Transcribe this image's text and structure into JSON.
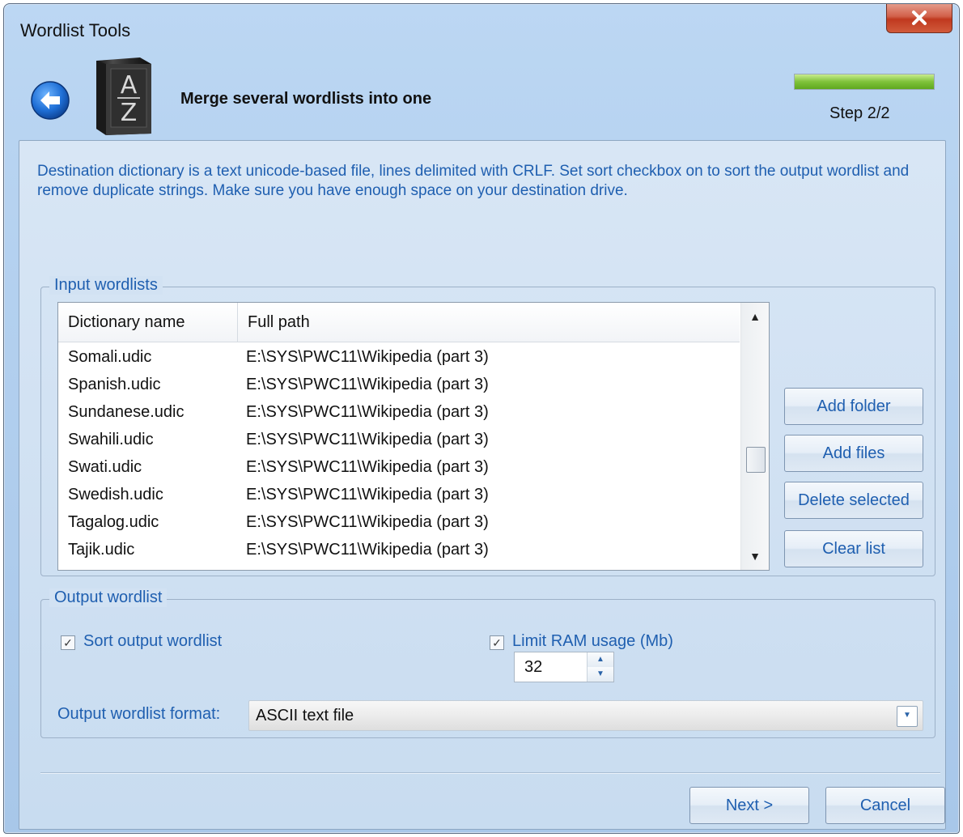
{
  "window": {
    "title": "Wordlist Tools"
  },
  "header": {
    "title": "Merge several wordlists into one",
    "step": "Step 2/2",
    "progress": 1.0
  },
  "description": "Destination dictionary is a text unicode-based file, lines delimited with CRLF. Set sort checkbox on to sort the output wordlist and remove duplicate strings. Make sure you have enough space on your destination drive.",
  "input_group": {
    "legend": "Input wordlists",
    "columns": [
      "Dictionary name",
      "Full path"
    ],
    "rows": [
      {
        "name": "Somali.udic",
        "path": "E:\\SYS\\PWC11\\Wikipedia (part 3)"
      },
      {
        "name": "Spanish.udic",
        "path": "E:\\SYS\\PWC11\\Wikipedia (part 3)"
      },
      {
        "name": "Sundanese.udic",
        "path": "E:\\SYS\\PWC11\\Wikipedia (part 3)"
      },
      {
        "name": "Swahili.udic",
        "path": "E:\\SYS\\PWC11\\Wikipedia (part 3)"
      },
      {
        "name": "Swati.udic",
        "path": "E:\\SYS\\PWC11\\Wikipedia (part 3)"
      },
      {
        "name": "Swedish.udic",
        "path": "E:\\SYS\\PWC11\\Wikipedia (part 3)"
      },
      {
        "name": "Tagalog.udic",
        "path": "E:\\SYS\\PWC11\\Wikipedia (part 3)"
      },
      {
        "name": "Tajik.udic",
        "path": "E:\\SYS\\PWC11\\Wikipedia (part 3)"
      }
    ],
    "buttons": {
      "add_folder": "Add folder",
      "add_files": "Add files",
      "delete_selected": "Delete selected",
      "clear_list": "Clear list"
    }
  },
  "output_group": {
    "legend": "Output wordlist",
    "sort_label": "Sort output wordlist",
    "sort_checked": true,
    "limit_label": "Limit RAM usage (Mb)",
    "limit_checked": true,
    "ram_value": "32",
    "format_label": "Output wordlist format:",
    "format_value": "ASCII text file"
  },
  "footer": {
    "next_label": "Next >",
    "cancel_label": "Cancel"
  },
  "icons": {
    "close": "close-icon",
    "back": "back-arrow-icon",
    "book": "book-az-icon"
  },
  "colors": {
    "accent_text": "#1f5fb0",
    "close_button": "#c0391f",
    "progress_fill": "#7fc23a"
  }
}
